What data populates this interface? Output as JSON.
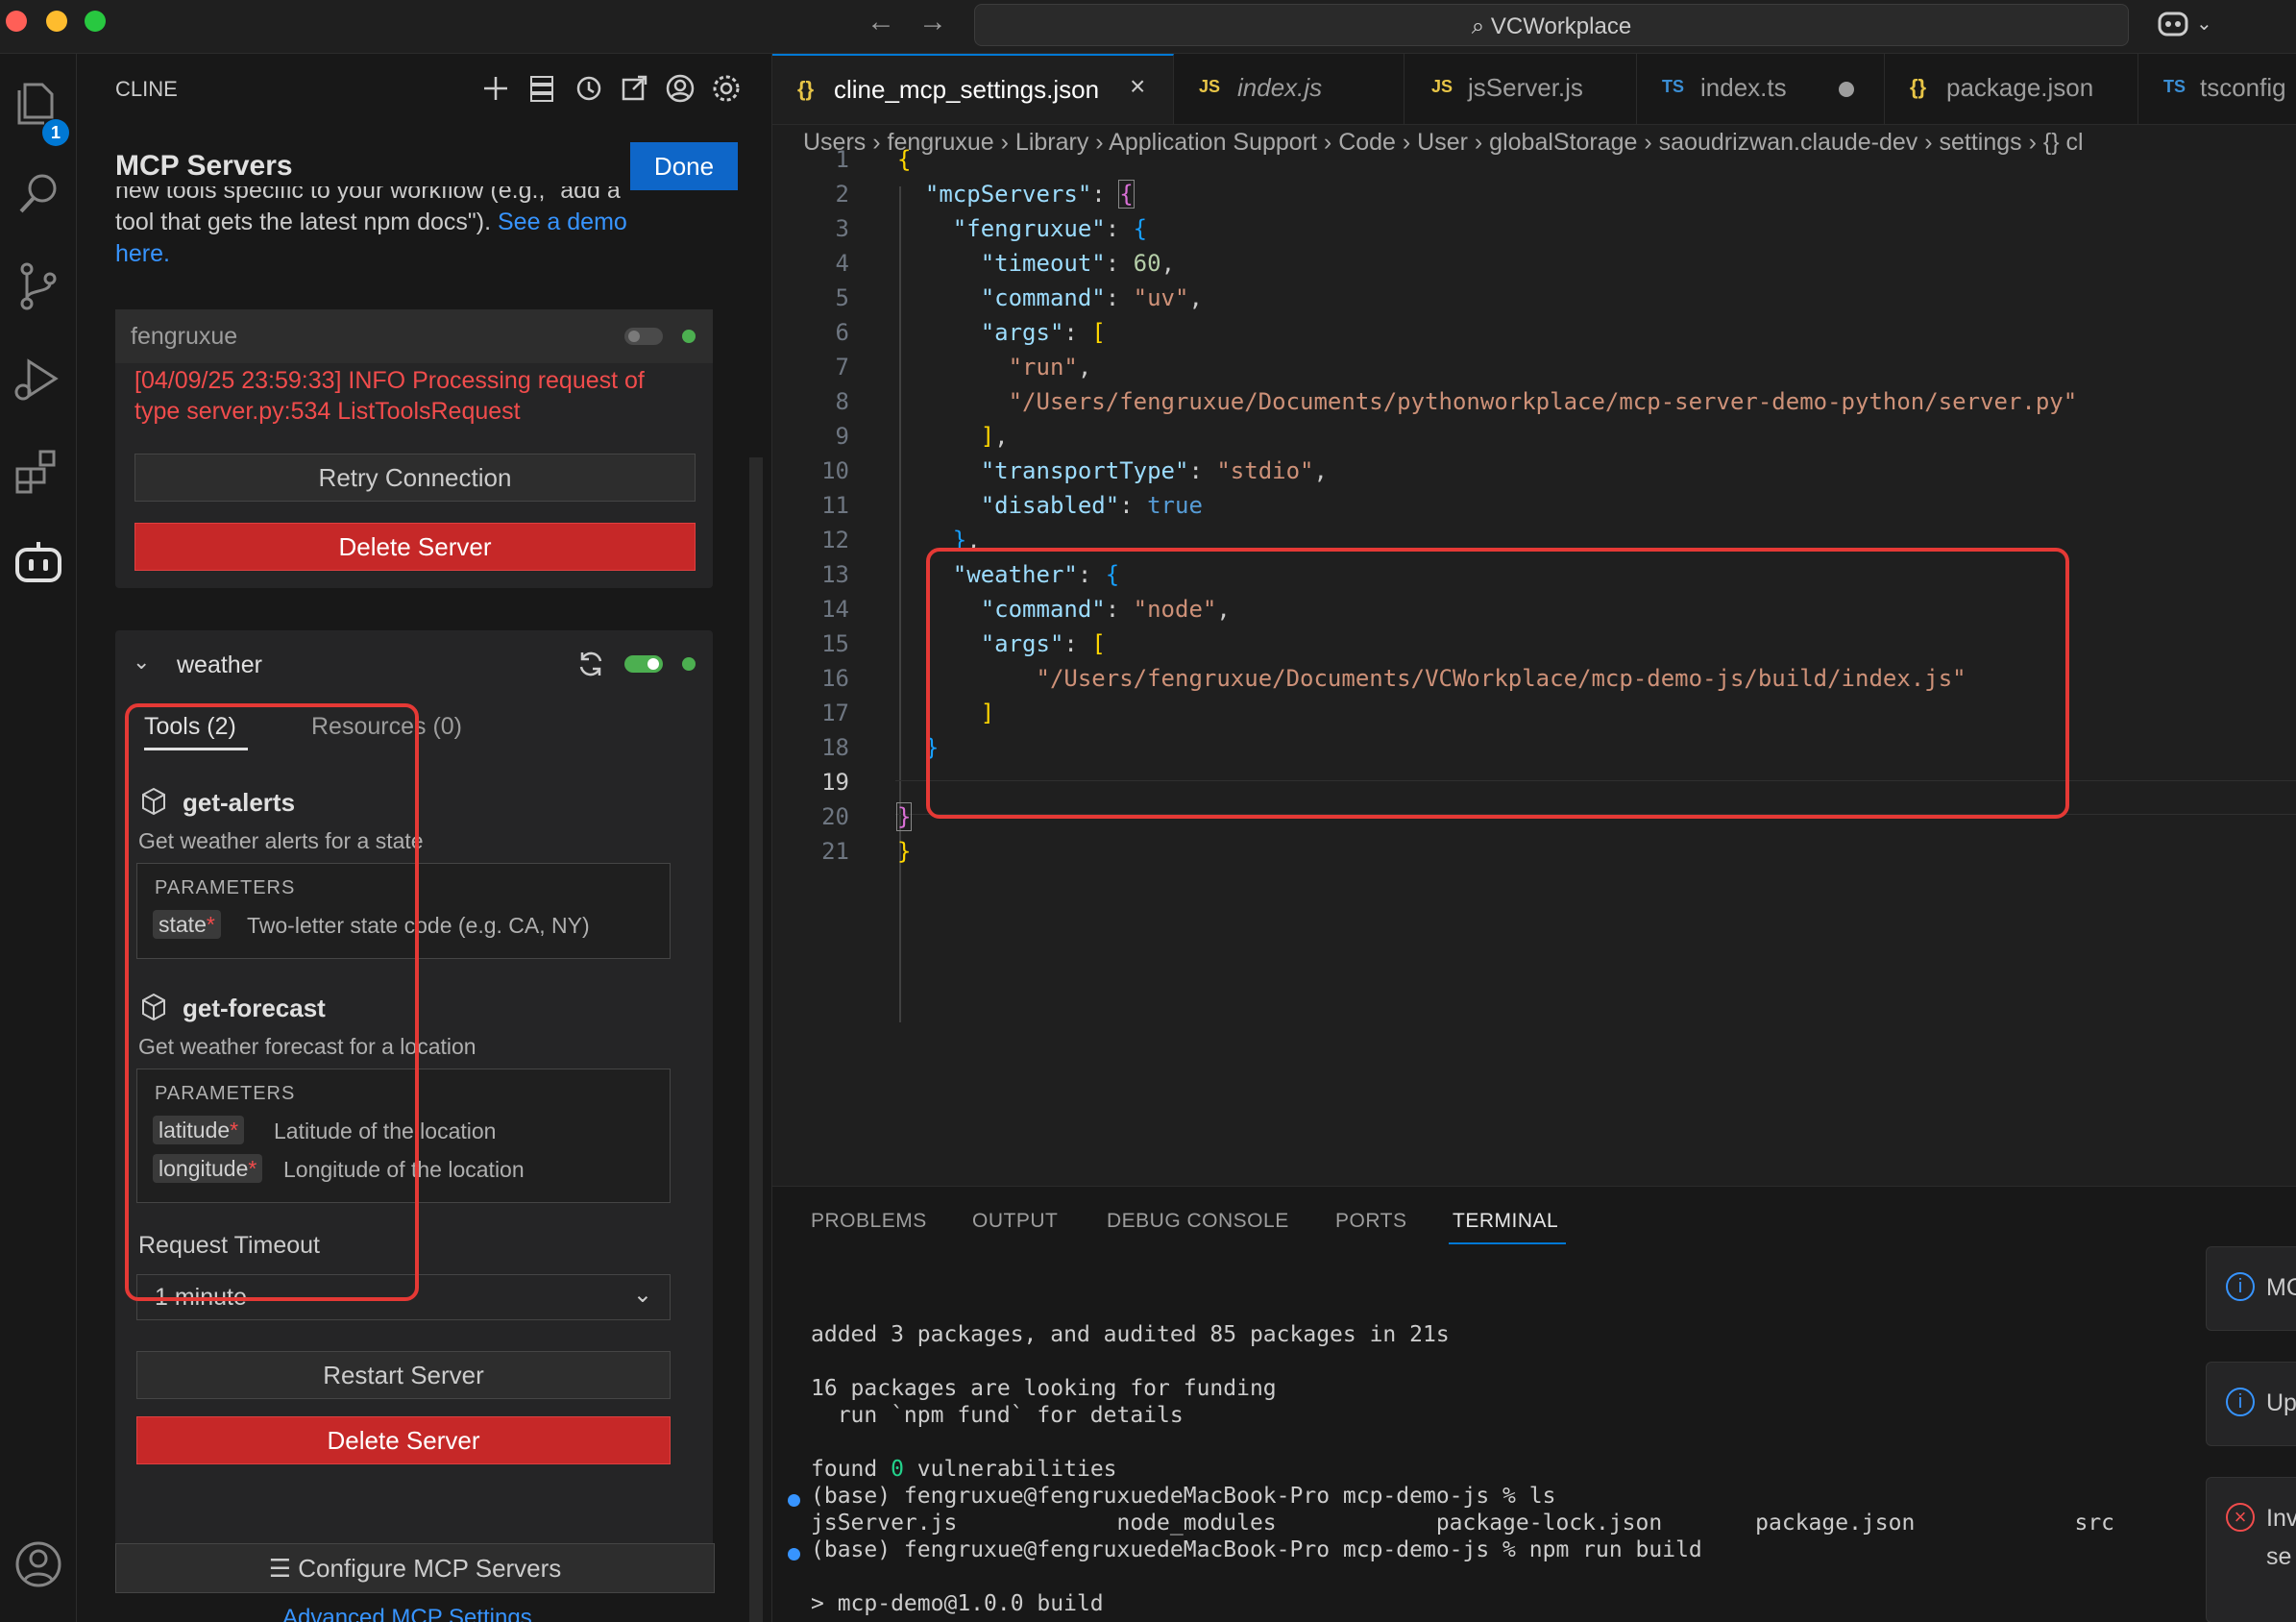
{
  "titlebar": {
    "search_text": "VCWorkplace"
  },
  "activity": {
    "explorer_badge": "1"
  },
  "sidebar": {
    "header": "CLINE",
    "mcp_title": "MCP Servers",
    "done_label": "Done",
    "intro_line1": "new tools specific to your workflow (e.g., \"add a",
    "intro_line2": "tool that gets the latest npm docs\"). ",
    "intro_link": "See a demo",
    "intro_link2": "here.",
    "servers": [
      {
        "name": "fengruxue",
        "error": "[04/09/25 23:59:33] INFO Processing request of type server.py:534 ListToolsRequest",
        "retry_label": "Retry Connection",
        "delete_label": "Delete Server"
      },
      {
        "name": "weather",
        "tabs": [
          "Tools (2)",
          "Resources (0)"
        ],
        "tools": [
          {
            "name": "get-alerts",
            "description": "Get weather alerts for a state",
            "params_header": "PARAMETERS",
            "params": [
              {
                "name": "state",
                "desc": "Two-letter state code (e.g. CA, NY)"
              }
            ]
          },
          {
            "name": "get-forecast",
            "description": "Get weather forecast for a location",
            "params_header": "PARAMETERS",
            "params": [
              {
                "name": "latitude",
                "desc": "Latitude of the location"
              },
              {
                "name": "longitude",
                "desc": "Longitude of the location"
              }
            ]
          }
        ],
        "timeout_label": "Request Timeout",
        "timeout_value": "1 minute",
        "restart_label": "Restart Server",
        "delete_label": "Delete Server"
      }
    ],
    "configure_label": "Configure MCP Servers",
    "advanced_label": "Advanced MCP Settings"
  },
  "editor": {
    "tabs": [
      {
        "icon": "{}",
        "name": "cline_mcp_settings.json",
        "active": true
      },
      {
        "icon": "JS",
        "name": "index.js"
      },
      {
        "icon": "JS",
        "name": "jsServer.js"
      },
      {
        "icon": "TS",
        "name": "index.ts"
      },
      {
        "icon": "{}",
        "name": "package.json"
      },
      {
        "icon": "TS",
        "name": "tsconfig"
      }
    ],
    "breadcrumb": "Users  ›  fengruxue  ›  Library  ›  Application Support  ›  Code  ›  User  ›  globalStorage  ›  saoudrizwan.claude-dev  ›  settings  ›  {}  cl",
    "current_line": "19"
  },
  "panel": {
    "tabs": [
      "PROBLEMS",
      "OUTPUT",
      "DEBUG CONSOLE",
      "PORTS",
      "TERMINAL"
    ],
    "active_tab": "TERMINAL",
    "terminal": {
      "l1": "added 3 packages, and audited 85 packages in 21s",
      "l2": "16 packages are looking for funding",
      "l3": "  run `npm fund` for details",
      "l4_prefix": "found ",
      "l4_zero": "0",
      "l4_suffix": " vulnerabilities",
      "l5": "(base) fengruxue@fengruxuedeMacBook-Pro mcp-demo-js % ls",
      "l6": "jsServer.js            node_modules            package-lock.json       package.json            src",
      "l7": "(base) fengruxue@fengruxuedeMacBook-Pro mcp-demo-js % npm run build",
      "l8": "> mcp-demo@1.0.0 build"
    },
    "notifications": [
      "MC",
      "Up",
      "Inv",
      "se"
    ]
  },
  "colors": {
    "accent": "#0078d4",
    "danger": "#c62828",
    "highlight": "#e53935",
    "status_ok": "#4caf50"
  }
}
